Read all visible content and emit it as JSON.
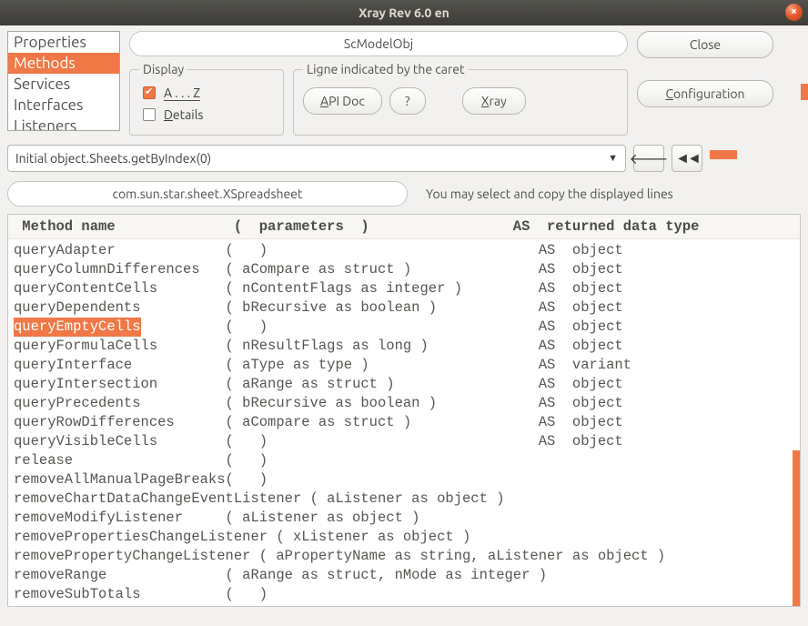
{
  "window": {
    "title": "Xray   Rev 6.0 en"
  },
  "nav": {
    "items": [
      {
        "label": "Properties",
        "selected": false
      },
      {
        "label": "Methods",
        "selected": true
      },
      {
        "label": "Services",
        "selected": false
      },
      {
        "label": "Interfaces",
        "selected": false
      },
      {
        "label": "Listeners",
        "selected": false
      }
    ]
  },
  "obj_field": "ScModelObj",
  "close_btn": "Close",
  "config_btn": "Configuration",
  "display": {
    "legend": "Display",
    "az_label": "A . . . Z",
    "az_checked": true,
    "details_label": "Details",
    "details_checked": false
  },
  "caret": {
    "legend": "Ligne indicated by the caret",
    "api_btn": "API Doc",
    "q_btn": "?",
    "xray_btn": "Xray"
  },
  "combo": {
    "value": "Initial object.Sheets.getByIndex(0)"
  },
  "iface_field": "com.sun.star.sheet.XSpreadsheet",
  "hint": "You may select and copy the displayed lines",
  "table": {
    "header": " Method name              (  parameters  )                 AS  returned data type",
    "rows": [
      {
        "name": "queryAdapter",
        "name_w": 25,
        "rest": "(   )                                AS  object"
      },
      {
        "name": "queryColumnDifferences",
        "name_w": 25,
        "rest": "( aCompare as struct )               AS  object"
      },
      {
        "name": "queryContentCells",
        "name_w": 25,
        "rest": "( nContentFlags as integer )         AS  object"
      },
      {
        "name": "queryDependents",
        "name_w": 25,
        "rest": "( bRecursive as boolean )            AS  object"
      },
      {
        "name": "queryEmptyCells",
        "name_w": 25,
        "rest": "(   )                                AS  object",
        "hl": true
      },
      {
        "name": "queryFormulaCells",
        "name_w": 25,
        "rest": "( nResultFlags as long )             AS  object"
      },
      {
        "name": "queryInterface",
        "name_w": 25,
        "rest": "( aType as type )                    AS  variant"
      },
      {
        "name": "queryIntersection",
        "name_w": 25,
        "rest": "( aRange as struct )                 AS  object"
      },
      {
        "name": "queryPrecedents",
        "name_w": 25,
        "rest": "( bRecursive as boolean )            AS  object"
      },
      {
        "name": "queryRowDifferences",
        "name_w": 25,
        "rest": "( aCompare as struct )               AS  object"
      },
      {
        "name": "queryVisibleCells",
        "name_w": 25,
        "rest": "(   )                                AS  object"
      },
      {
        "name": "release",
        "name_w": 25,
        "rest": "(   )"
      },
      {
        "name": "removeAllManualPageBreaks",
        "name_w": 25,
        "rest": "(   )"
      },
      {
        "name": "removeChartDataChangeEventListener",
        "name_w": 0,
        "rest": " ( aListener as object )"
      },
      {
        "name": "removeModifyListener",
        "name_w": 25,
        "rest": "( aListener as object )"
      },
      {
        "name": "removePropertiesChangeListener",
        "name_w": 0,
        "rest": " ( xListener as object )"
      },
      {
        "name": "removePropertyChangeListener",
        "name_w": 0,
        "rest": " ( aPropertyName as string, aListener as object )"
      },
      {
        "name": "removeRange",
        "name_w": 25,
        "rest": "( aRange as struct, nMode as integer )"
      },
      {
        "name": "removeSubTotals",
        "name_w": 25,
        "rest": "(   )"
      }
    ]
  }
}
